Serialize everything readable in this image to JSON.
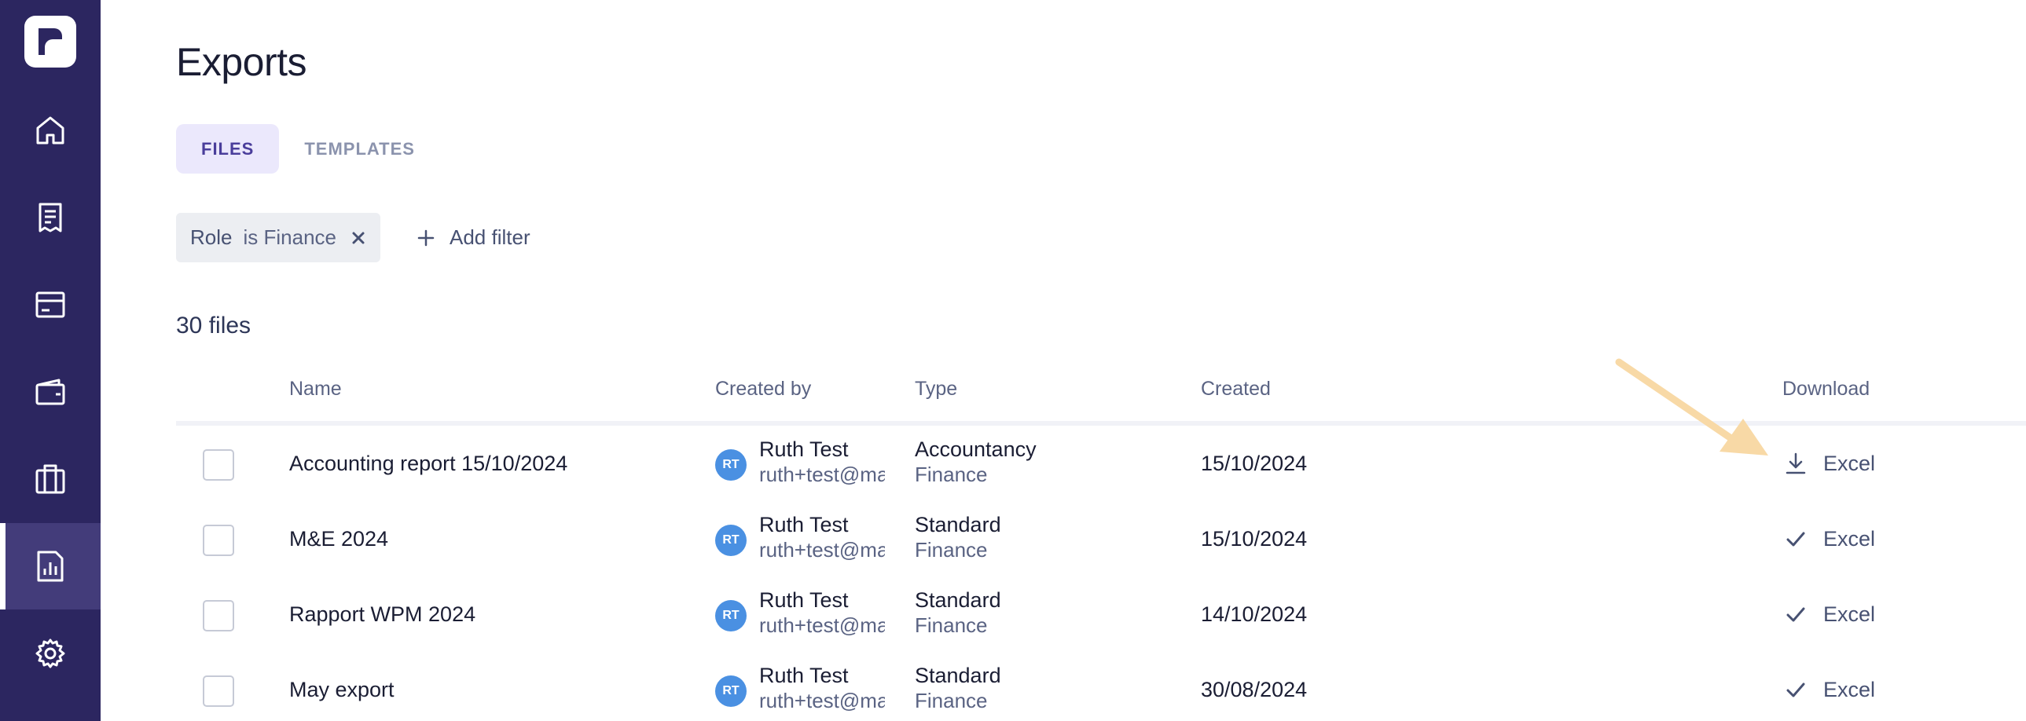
{
  "app": {
    "logo": "rippling-style-logo",
    "accent": "#2c2660",
    "active_accent": "#433c7a"
  },
  "sidebar": {
    "items": [
      {
        "icon": "home-icon",
        "active": false
      },
      {
        "icon": "receipt-icon",
        "active": false
      },
      {
        "icon": "card-icon",
        "active": false
      },
      {
        "icon": "wallet-icon",
        "active": false
      },
      {
        "icon": "building-icon",
        "active": false
      },
      {
        "icon": "report-chart-icon",
        "active": true
      },
      {
        "icon": "gear-icon",
        "active": false
      }
    ]
  },
  "page": {
    "title": "Exports"
  },
  "tabs": [
    {
      "label": "FILES",
      "active": true
    },
    {
      "label": "TEMPLATES",
      "active": false
    }
  ],
  "filters": {
    "chip": {
      "field": "Role",
      "clause": "is Finance"
    },
    "add_label": "Add filter"
  },
  "file_count": "30 files",
  "table": {
    "headers": {
      "name": "Name",
      "created_by": "Created by",
      "type": "Type",
      "created": "Created",
      "download": "Download"
    },
    "rows": [
      {
        "name": "Accounting report 15/10/2024",
        "initials": "RT",
        "creator": "Ruth Test",
        "email": "ruth+test@mail.com",
        "type": "Accountancy",
        "role": "Finance",
        "created": "15/10/2024",
        "download": "Excel",
        "download_icon": "download-icon"
      },
      {
        "name": "M&E 2024",
        "initials": "RT",
        "creator": "Ruth Test",
        "email": "ruth+test@mail.com",
        "type": "Standard",
        "role": "Finance",
        "created": "15/10/2024",
        "download": "Excel",
        "download_icon": "check-icon"
      },
      {
        "name": "Rapport WPM 2024",
        "initials": "RT",
        "creator": "Ruth Test",
        "email": "ruth+test@mail.com",
        "type": "Standard",
        "role": "Finance",
        "created": "14/10/2024",
        "download": "Excel",
        "download_icon": "check-icon"
      },
      {
        "name": "May export",
        "initials": "RT",
        "creator": "Ruth Test",
        "email": "ruth+test@mail.com",
        "type": "Standard",
        "role": "Finance",
        "created": "30/08/2024",
        "download": "Excel",
        "download_icon": "check-icon"
      }
    ]
  },
  "annotation": {
    "icon": "pointer-arrow-icon",
    "color": "#f8d9a6"
  }
}
